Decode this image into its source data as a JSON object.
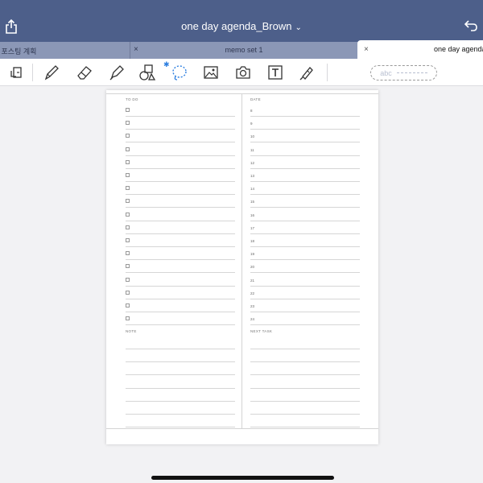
{
  "titlebar": {
    "title": "one day agenda_Brown",
    "chevron": "⌄",
    "share_icon": "share-icon",
    "undo_icon": "undo-icon",
    "color": "#4d5f8a"
  },
  "tabs": [
    {
      "label": "g 포스팅 계획",
      "active": false
    },
    {
      "label": "memo set 1",
      "close": "×",
      "active": false
    },
    {
      "label": "one day agenda",
      "close": "×",
      "active": true
    }
  ],
  "toolbar": {
    "tools": [
      "page-export-icon",
      "pen-icon",
      "eraser-icon",
      "highlighter-icon",
      "shapes-icon",
      "lasso-icon",
      "image-icon",
      "camera-icon",
      "text-icon",
      "laser-pointer-icon"
    ],
    "bluetooth_mark": "✱",
    "text_field_placeholder": "abc",
    "accent_color": "#2d7fe0"
  },
  "planner": {
    "todo_label": "TO DO",
    "date_label": "DATE",
    "note_label": "NOTE",
    "next_task_label": "NEXT TASK",
    "hours": [
      "8",
      "9",
      "10",
      "11",
      "12",
      "13",
      "14",
      "15",
      "16",
      "17",
      "18",
      "19",
      "20",
      "21",
      "22",
      "23",
      "24"
    ],
    "todo_rows": 17,
    "note_rows": 7,
    "next_task_rows": 7
  }
}
